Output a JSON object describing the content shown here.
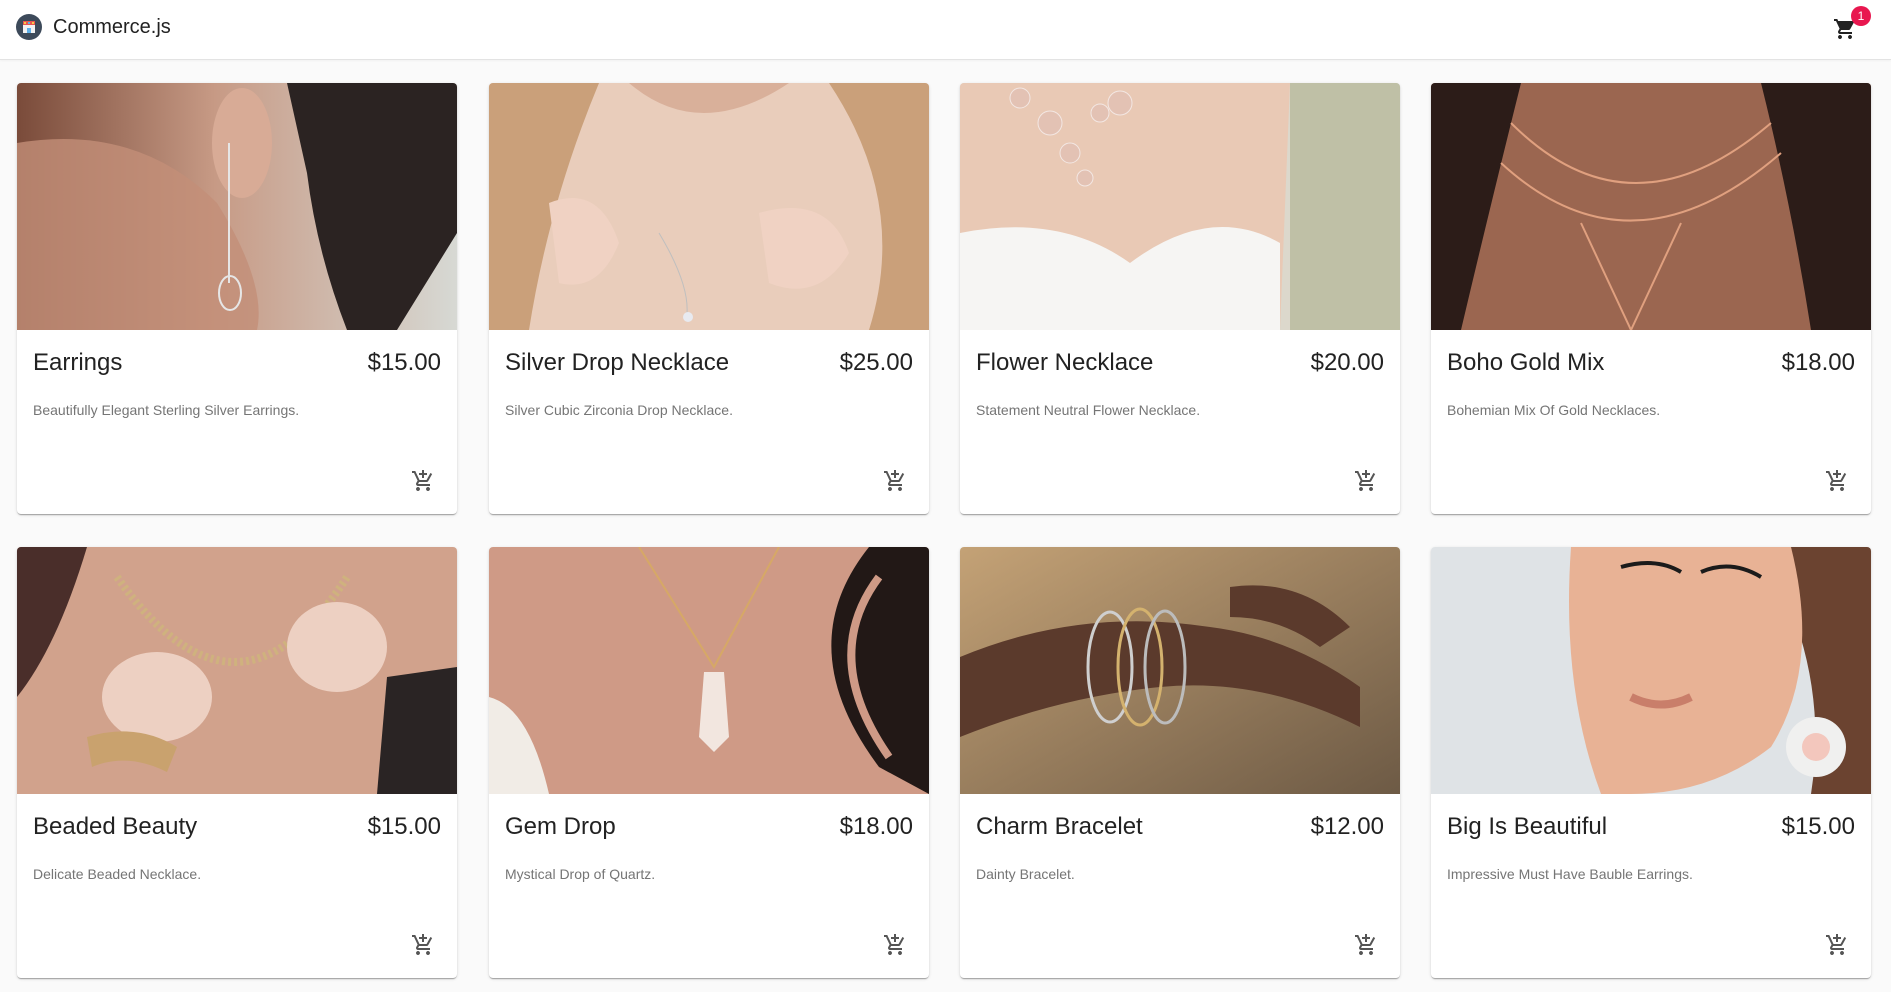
{
  "app": {
    "title": "Commerce.js",
    "logo_icon": "store-logo-icon",
    "cart_icon": "shopping-cart-icon",
    "cart_count": "1",
    "badge_color": "#e8174f"
  },
  "products": [
    {
      "name": "Earrings",
      "price": "$15.00",
      "description": "Beautifully Elegant Sterling Silver Earrings.",
      "image": "earrings-photo"
    },
    {
      "name": "Silver Drop Necklace",
      "price": "$25.00",
      "description": "Silver Cubic Zirconia Drop Necklace.",
      "image": "silver-drop-necklace-photo"
    },
    {
      "name": "Flower Necklace",
      "price": "$20.00",
      "description": "Statement Neutral Flower Necklace.",
      "image": "flower-necklace-photo"
    },
    {
      "name": "Boho Gold Mix",
      "price": "$18.00",
      "description": "Bohemian Mix Of Gold Necklaces.",
      "image": "boho-gold-mix-photo"
    },
    {
      "name": "Beaded Beauty",
      "price": "$15.00",
      "description": "Delicate Beaded Necklace.",
      "image": "beaded-beauty-photo"
    },
    {
      "name": "Gem Drop",
      "price": "$18.00",
      "description": "Mystical Drop of Quartz.",
      "image": "gem-drop-photo"
    },
    {
      "name": "Charm Bracelet",
      "price": "$12.00",
      "description": "Dainty Bracelet.",
      "image": "charm-bracelet-photo"
    },
    {
      "name": "Big Is Beautiful",
      "price": "$15.00",
      "description": "Impressive Must Have Bauble Earrings.",
      "image": "big-is-beautiful-photo"
    }
  ]
}
